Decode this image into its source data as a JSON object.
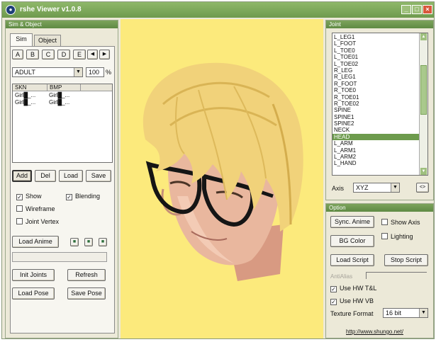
{
  "window": {
    "title": "rshe Viewer v1.0.8",
    "app_icon": "app-icon"
  },
  "left_panel": {
    "header": "Sim & Object",
    "tabs": [
      {
        "label": "Sim"
      },
      {
        "label": "Object"
      }
    ],
    "letter_tabs": [
      "A",
      "B",
      "C",
      "D",
      "E"
    ],
    "nav_arrows": [
      "◀",
      "▶"
    ],
    "age_select": "ADULT",
    "scale_value": "100",
    "scale_unit": "%",
    "table_headers": [
      "SKN",
      "BMP"
    ],
    "table_rows": [
      [
        "Girl█_...",
        "Girl█_..."
      ],
      [
        "Girl█_...",
        "Girl█_..."
      ]
    ],
    "buttons": {
      "add": "Add",
      "del": "Del",
      "load": "Load",
      "save": "Save"
    },
    "checkboxes": {
      "show": {
        "label": "Show",
        "checked": true
      },
      "blending": {
        "label": "Blending",
        "checked": true
      },
      "wireframe": {
        "label": "Wireframe",
        "checked": false
      },
      "joint_vertex": {
        "label": "Joint Vertex",
        "checked": false
      }
    },
    "load_anime": "Load Anime",
    "playback_icons": [
      "play-icon",
      "stop-icon",
      "pause-icon"
    ],
    "init_joints": "Init Joints",
    "refresh": "Refresh",
    "load_pose": "Load Pose",
    "save_pose": "Save Pose"
  },
  "joint_panel": {
    "header": "Joint",
    "items": [
      "L_LEG1",
      "L_FOOT",
      "L_TOE0",
      "L_TOE01",
      "L_TOE02",
      "R_LEG",
      "R_LEG1",
      "R_FOOT",
      "R_TOE0",
      "R_TOE01",
      "R_TOE02",
      "SPINE",
      "SPINE1",
      "SPINE2",
      "NECK",
      "HEAD",
      "L_ARM",
      "L_ARM1",
      "L_ARM2",
      "L_HAND"
    ],
    "selected": "HEAD",
    "axis_label": "Axis",
    "axis_value": "XYZ",
    "reset_label": "<>"
  },
  "option_panel": {
    "header": "Option",
    "sync_anime": "Sync. Anime",
    "show_axis": {
      "label": "Show Axis",
      "checked": false
    },
    "bg_color": "BG Color",
    "lighting": {
      "label": "Lighting",
      "checked": false
    },
    "load_script": "Load Script",
    "stop_script": "Stop Script",
    "anti_alias_label": "AntiAlias",
    "use_hw_tl": {
      "label": "Use HW T&L",
      "checked": true
    },
    "use_hw_vb": {
      "label": "Use HW VB",
      "checked": true
    },
    "texture_format_label": "Texture Format",
    "texture_format_value": "16 bit",
    "url": "http://www.shungo.net/"
  },
  "colors": {
    "viewport_bg": "#fcea7c",
    "accent_green": "#6d9b4d",
    "hair": "#f1d27a",
    "skin": "#e9b79e"
  }
}
